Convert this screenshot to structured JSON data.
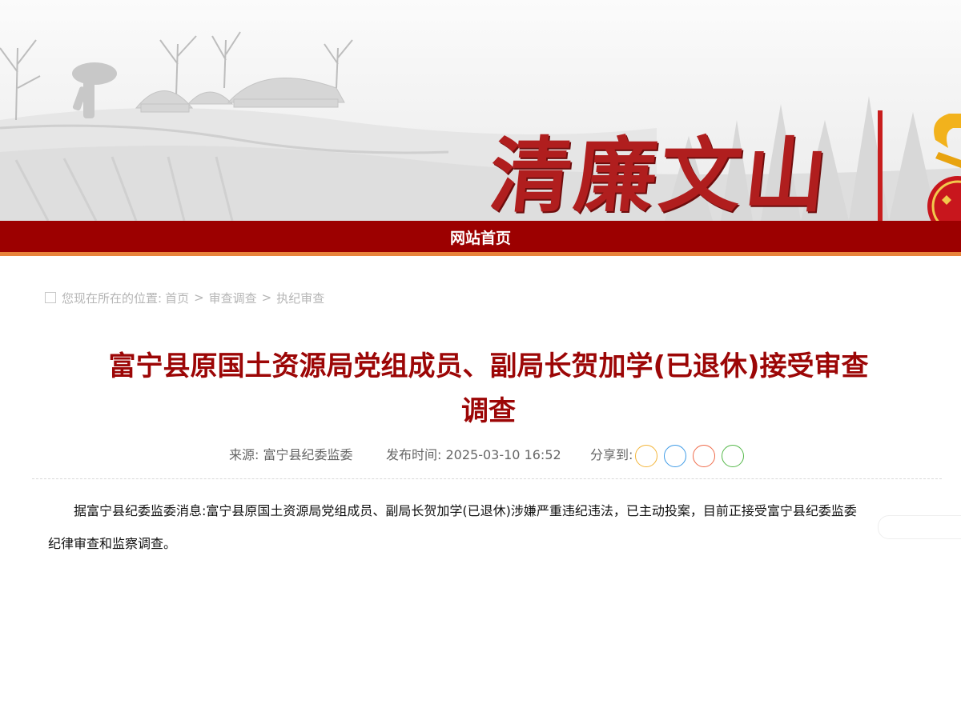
{
  "banner": {
    "logo_text": "清廉文山"
  },
  "nav": {
    "home_label": "网站首页"
  },
  "breadcrumb": {
    "prefix": "您现在所在的位置:",
    "items": [
      "首页",
      "审查调查",
      "执纪审查"
    ],
    "separator": ">"
  },
  "article": {
    "title": "富宁县原国土资源局党组成员、副局长贺加学(已退休)接受审查调查",
    "source_label": "来源:",
    "source_value": "富宁县纪委监委",
    "time_label": "发布时间:",
    "time_value": "2025-03-10 16:52",
    "share_label": "分享到:",
    "body": "据富宁县纪委监委消息:富宁县原国土资源局党组成员、副局长贺加学(已退休)涉嫌严重违纪违法，已主动投案，目前正接受富宁县纪委监委纪律审查和监察调查。"
  },
  "colors": {
    "nav_bar": "#9c0000",
    "nav_accent": "#e8833a",
    "title": "#9c0606",
    "logo": "#b01e1e",
    "share": [
      "#f3b53a",
      "#3e9be6",
      "#ef6b4a",
      "#55b84a"
    ]
  }
}
